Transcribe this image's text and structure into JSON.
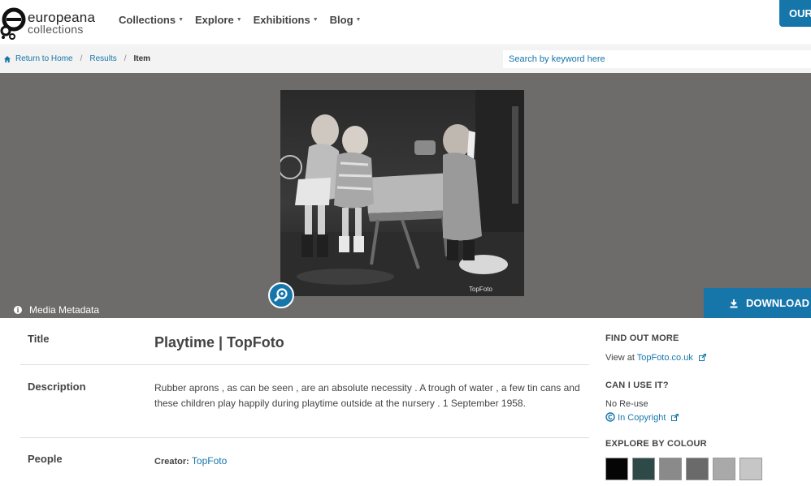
{
  "header": {
    "logo_word": "europeana",
    "logo_sub": "collections",
    "nav": [
      {
        "label": "Collections"
      },
      {
        "label": "Explore"
      },
      {
        "label": "Exhibitions"
      },
      {
        "label": "Blog"
      }
    ],
    "corner_button": "OUR"
  },
  "breadcrumb": {
    "home": "Return to Home",
    "results": "Results",
    "current": "Item",
    "separator": "/"
  },
  "search": {
    "placeholder": "Search by keyword here"
  },
  "media": {
    "metadata_link": "Media Metadata",
    "download_label": "DOWNLOAD",
    "watermark": "TopFoto"
  },
  "item": {
    "title_label": "Title",
    "title": "Playtime | TopFoto",
    "description_label": "Description",
    "description": "Rubber aprons , as can be seen , are an absolute necessity . A trough of water , a few tin cans and these children play happily during playtime outside at the nursery . 1 September 1958.",
    "people_label": "People",
    "creator_label": "Creator:",
    "creator": "TopFoto"
  },
  "sidebar": {
    "find_out_more": "FIND OUT MORE",
    "view_at": "View at",
    "view_at_link": "TopFoto.co.uk",
    "can_i_use": "CAN I USE IT?",
    "rights_text": "No Re-use",
    "rights_link": "In Copyright",
    "explore_colour": "EXPLORE BY COLOUR",
    "swatches": [
      "#050505",
      "#2e4a48",
      "#8a8a8a",
      "#6a6a6a",
      "#a9a9a9",
      "#c6c6c6"
    ]
  },
  "colors": {
    "accent": "#1676aa",
    "media_bg": "#6e6b6b"
  }
}
